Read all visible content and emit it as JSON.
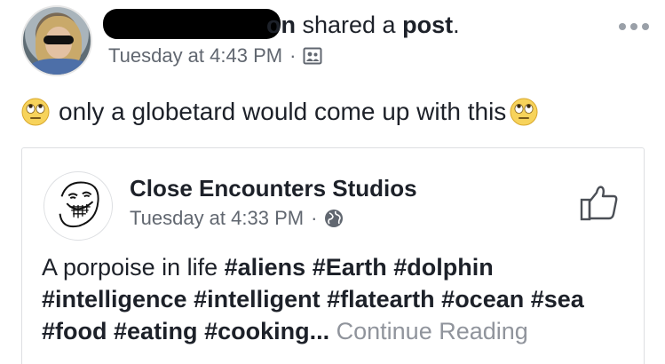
{
  "header": {
    "author_tail": "on",
    "shared_text": " shared a ",
    "post_word": "post",
    "period": ".",
    "timestamp": "Tuesday at 4:43 PM",
    "separator": "·"
  },
  "icons": {
    "audience": "friends-audience-icon",
    "more": "more-options-icon",
    "emoji": "eye-roll-emoji",
    "globe": "globe-icon",
    "like": "like-page-icon"
  },
  "post": {
    "text": "only a globetard would come up with this"
  },
  "shared_post": {
    "page_name": "Close Encounters Studios",
    "timestamp": "Tuesday at 4:33 PM",
    "separator": "·",
    "text_plain": "A porpoise in life ",
    "hashtags": [
      "#aliens",
      "#Earth",
      "#dolphin",
      "#intelligence",
      "#intelligent",
      "#flatearth",
      "#ocean",
      "#sea",
      "#food",
      "#eating",
      "#cooking"
    ],
    "ellipsis": "...",
    "continue_label": "Continue Reading"
  },
  "colors": {
    "text": "#1d2129",
    "meta": "#616770",
    "muted_link": "#90949c",
    "border": "#dddfe2"
  }
}
